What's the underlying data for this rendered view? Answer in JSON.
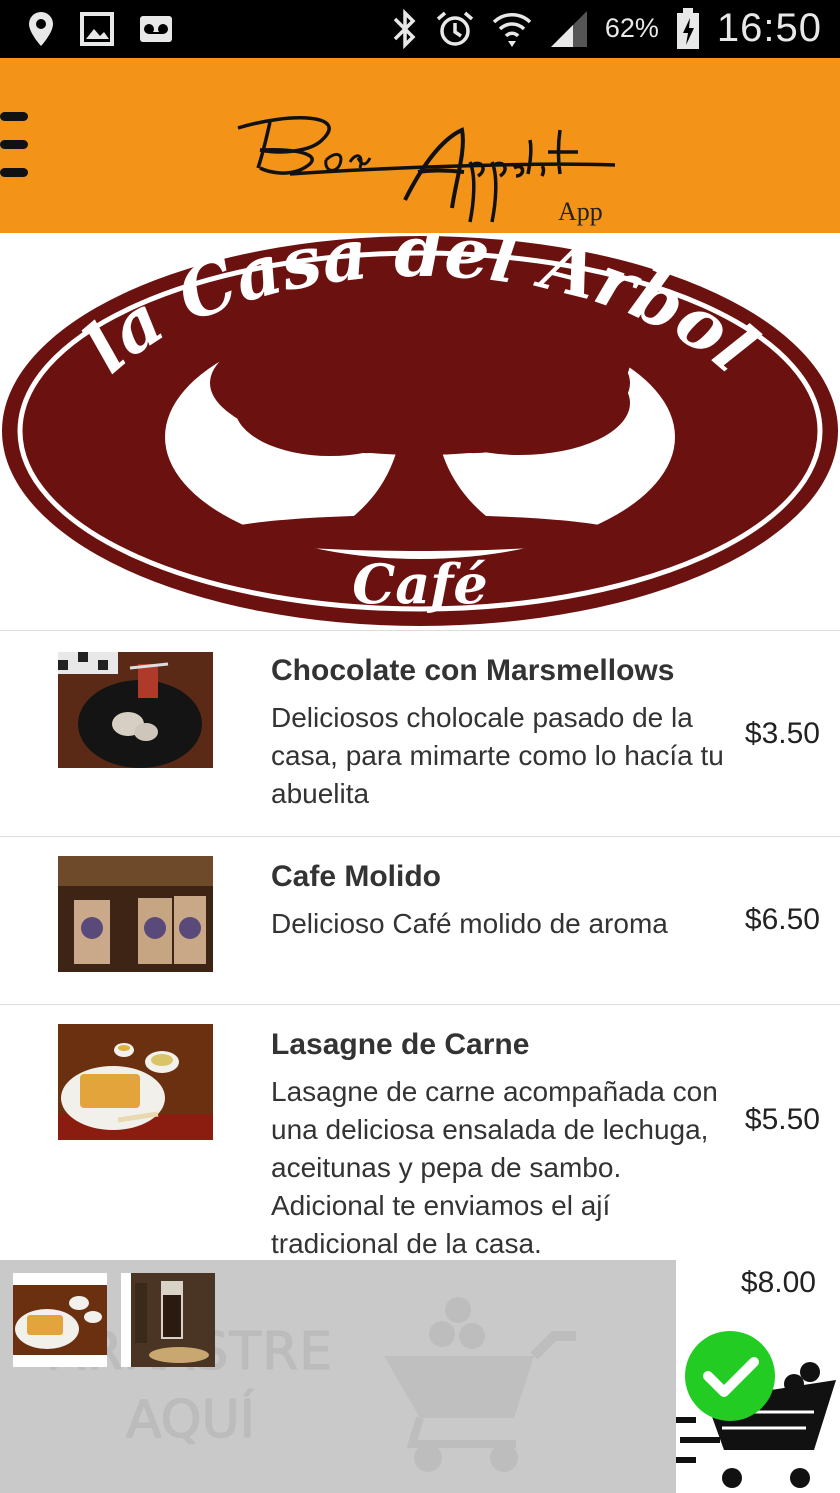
{
  "status_bar": {
    "battery_percent": "62%",
    "time": "16:50",
    "icons": [
      "location-icon",
      "gallery-icon",
      "voicemail-icon",
      "bluetooth-icon",
      "alarm-icon",
      "wifi-icon",
      "signal-icon",
      "battery-charging-icon"
    ]
  },
  "app_bar": {
    "brand_name": "Bon Appetit",
    "brand_suffix": "App",
    "accent_color": "#f39419"
  },
  "restaurant": {
    "name_line": "la Casa del Arbol",
    "subtitle": "Café",
    "brand_color": "#6b1210"
  },
  "menu": {
    "items": [
      {
        "name": "Chocolate con Marsmellows",
        "description": "Deliciosos cholocale pasado de la casa, para mimarte como lo hacía tu abuelita",
        "price": "$3.50"
      },
      {
        "name": "Cafe Molido",
        "description": "Delicioso Café molido de aroma",
        "price": "$6.50"
      },
      {
        "name": "Lasagne de Carne",
        "description": "Lasagne de carne acompañada con una deliciosa ensalada de lechuga, aceitunas y pepa de sambo. Adicional te enviamos el ají tradicional de la casa.",
        "price": "$5.50"
      }
    ],
    "partial_item_price": "$8.00"
  },
  "cart": {
    "drop_hint_line1": "ARRASTRE",
    "drop_hint_line2": "AQUÍ",
    "confirm_color": "#22cc22"
  }
}
